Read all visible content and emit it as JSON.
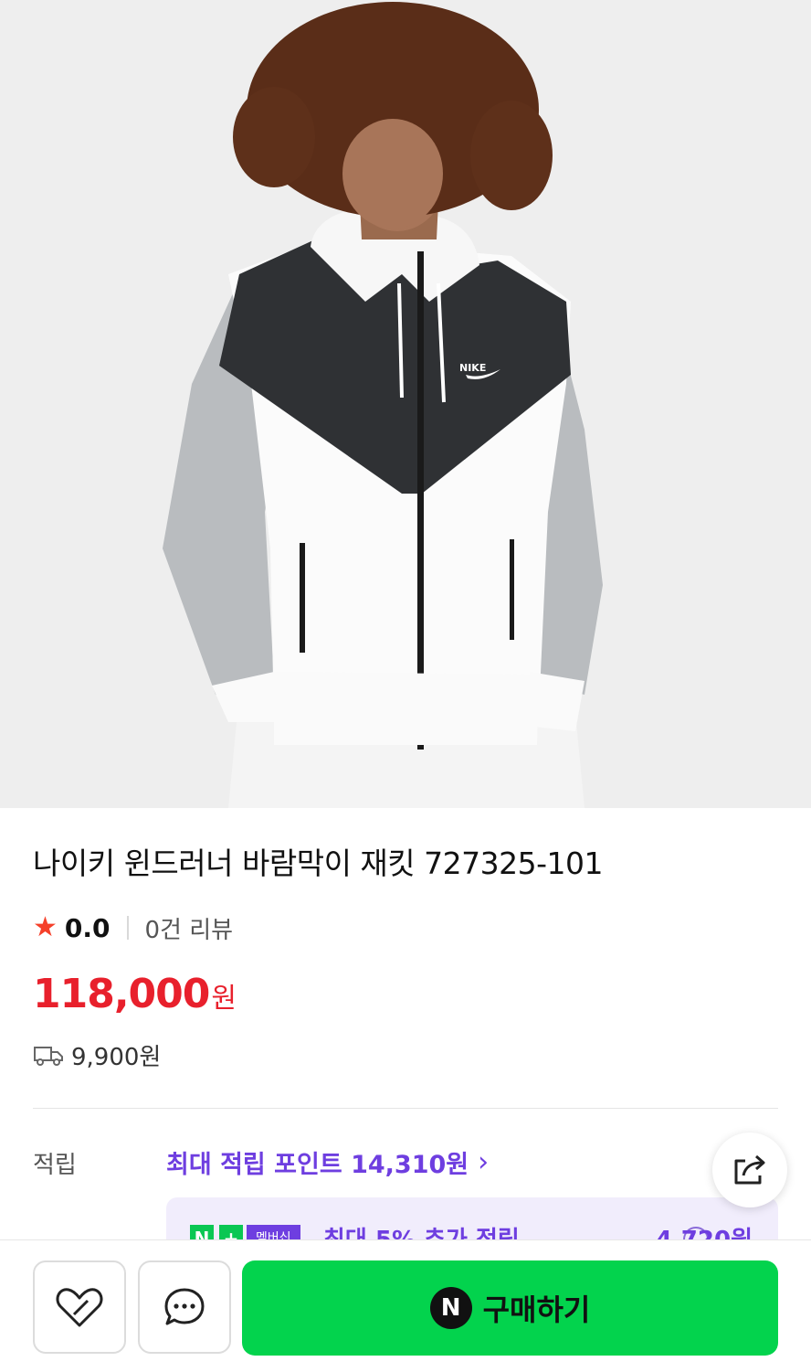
{
  "product": {
    "title": "나이키 윈드러너 바람막이 재킷 727325-101",
    "rating": "0.0",
    "review_count": "0건 리뷰",
    "price": "118,000",
    "price_unit": "원",
    "shipping_fee": "9,900원",
    "image_logo": "NIKE"
  },
  "points": {
    "label": "적립",
    "max_points": "최대 적립 포인트 14,310원",
    "membership_text": "최대 5% 추가 적립",
    "membership_amount": "4,720원",
    "membership_badge_n": "N",
    "membership_badge_plus": "+",
    "membership_badge_label": "멤버십"
  },
  "actions": {
    "buy_label": "구매하기",
    "buy_icon_letter": "N"
  },
  "icons": {
    "star": "star-icon",
    "shipping": "truck-icon",
    "share": "share-icon",
    "like": "heart-icon",
    "chat": "chat-bubble-icon"
  },
  "colors": {
    "price": "#e8202c",
    "points": "#6e3ee0",
    "buy": "#03d34d",
    "star": "#f5402a"
  }
}
